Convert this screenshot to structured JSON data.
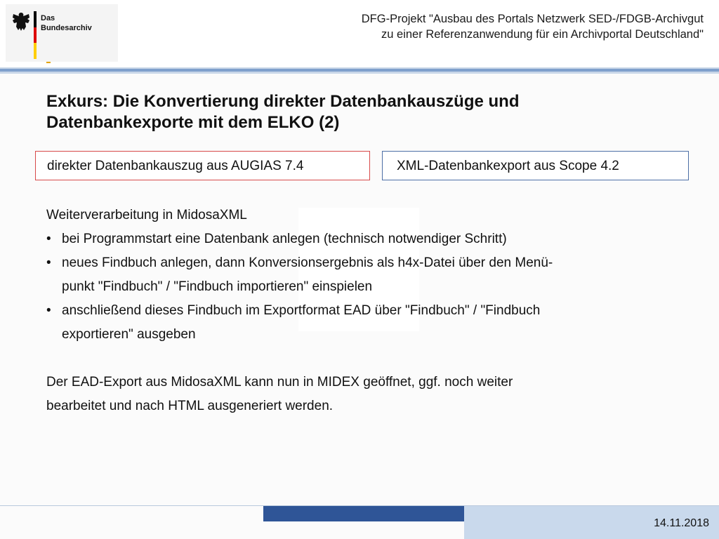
{
  "header": {
    "logo_line1": "Das",
    "logo_line2": "Bundesarchiv",
    "title_line1": "DFG-Projekt \"Ausbau des Portals Netzwerk SED-/FDGB-Archivgut",
    "title_line2": "zu einer Referenzanwendung für ein Archivportal Deutschland\""
  },
  "slide": {
    "heading_line1": "Exkurs: Die Konvertierung direkter Datenbankauszüge und",
    "heading_line2": "Datenbankexporte mit dem ELKO (2)",
    "box_left": "direkter Datenbankauszug aus AUGIAS 7.4",
    "box_right": "XML-Datenbankexport aus Scope 4.2",
    "intro": "Weiterverarbeitung in MidosaXML",
    "bullets": [
      {
        "line1": "bei Programmstart eine Datenbank anlegen (technisch notwendiger Schritt)",
        "line2": ""
      },
      {
        "line1": "neues Findbuch anlegen, dann Konversionsergebnis als h4x-Datei über den Menü-",
        "line2": "punkt \"Findbuch\" / \"Findbuch importieren\" einspielen"
      },
      {
        "line1": "anschließend dieses Findbuch im Exportformat EAD über \"Findbuch\" / \"Findbuch",
        "line2": "exportieren\" ausgeben"
      }
    ],
    "bullet_glyph": "•",
    "closing_line1": "Der EAD-Export aus MidosaXML kann nun in MIDEX geöffnet, ggf. noch weiter",
    "closing_line2": "bearbeitet und nach HTML ausgeneriert werden."
  },
  "footer": {
    "date": "14.11.2018"
  },
  "colors": {
    "flag_black": "#000000",
    "flag_red": "#dd0000",
    "flag_gold": "#ffce00",
    "box_left_border": "#d84a4a",
    "box_right_border": "#4d6fa6",
    "footer_dark": "#2f5597",
    "footer_light": "#c9d9ec"
  }
}
